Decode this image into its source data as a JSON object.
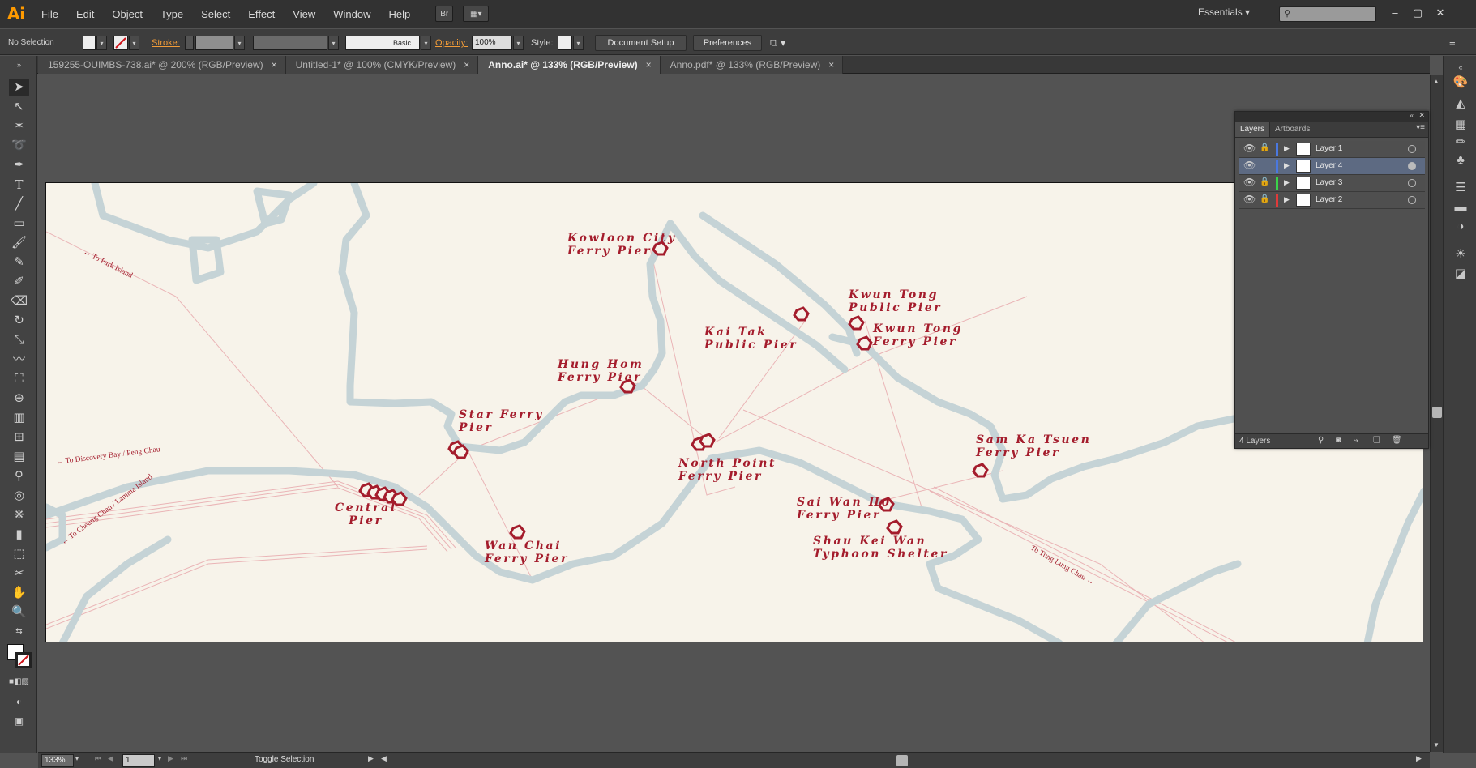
{
  "app": {
    "logo": "Ai",
    "menu": [
      "File",
      "Edit",
      "Object",
      "Type",
      "Select",
      "Effect",
      "View",
      "Window",
      "Help"
    ],
    "bridge_label": "Br",
    "workspace": "Essentials",
    "search_placeholder": ""
  },
  "control_bar": {
    "selection": "No Selection",
    "stroke_label": "Stroke:",
    "stroke_profile": "Basic",
    "opacity_label": "Opacity:",
    "opacity_value": "100%",
    "style_label": "Style:",
    "document_setup": "Document Setup",
    "preferences": "Preferences"
  },
  "tabs": [
    {
      "label": "159255-OUIMBS-738.ai* @ 200% (RGB/Preview)",
      "active": false
    },
    {
      "label": "Untitled-1* @ 100% (CMYK/Preview)",
      "active": false
    },
    {
      "label": "Anno.ai* @ 133% (RGB/Preview)",
      "active": true
    },
    {
      "label": "Anno.pdf* @ 133% (RGB/Preview)",
      "active": false
    }
  ],
  "tab_close_glyph": "×",
  "map": {
    "marker_color": "#a41c2c",
    "coast_color": "#c5d3d6",
    "route_color": "#eab4b6",
    "paper_color": "#f7f3ea",
    "labels": {
      "kowloon_city": "Kowloon City\nFerry Pier",
      "kwun_tong_public": "Kwun Tong\nPublic Pier",
      "kai_tak": "Kai Tak\nPublic Pier",
      "kwun_tong_ferry": "Kwun Tong\nFerry Pier",
      "hung_hom": "Hung Hom\nFerry Pier",
      "star_ferry": "Star Ferry\nPier",
      "north_point": "North Point\nFerry Pier",
      "sam_ka_tsuen": "Sam Ka Tsuen\nFerry Pier",
      "central": "Central\nPier",
      "sai_wan_ho": "Sai Wan Ho\nFerry Pier",
      "shau_kei_wan": "Shau Kei Wan\nTyphoon Shelter",
      "wan_chai": "Wan Chai\nFerry Pier"
    },
    "directions": {
      "park_island": "← To Park Island",
      "discovery_bay": "← To Discovery Bay / Peng Chau",
      "cheung_chau": "← To Cheung Chau / Lamma Island",
      "tung_lung_chau": "To Tung Lung Chau →"
    }
  },
  "layers_panel": {
    "tabs": [
      "Layers",
      "Artboards"
    ],
    "layers": [
      {
        "name": "Layer 1",
        "color": "#4a78e0",
        "locked": true,
        "selected": false
      },
      {
        "name": "Layer 4",
        "color": "#4a78e0",
        "locked": false,
        "selected": true
      },
      {
        "name": "Layer 3",
        "color": "#3bd34a",
        "locked": true,
        "selected": false
      },
      {
        "name": "Layer 2",
        "color": "#e03a3a",
        "locked": true,
        "selected": false
      }
    ],
    "count": "4 Layers"
  },
  "status_bar": {
    "zoom": "133%",
    "artboard": "1",
    "status": "Toggle Selection"
  }
}
